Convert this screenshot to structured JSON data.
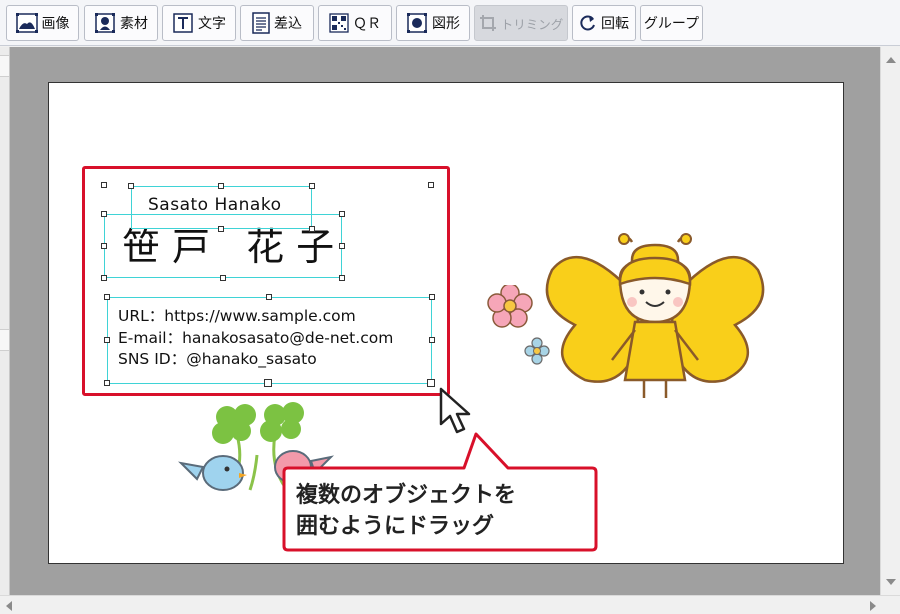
{
  "toolbar": {
    "buttons": [
      {
        "label": "画像",
        "icon": "image-icon",
        "enabled": true
      },
      {
        "label": "素材",
        "icon": "material-icon",
        "enabled": true
      },
      {
        "label": "文字",
        "icon": "text-icon",
        "enabled": true
      },
      {
        "label": "差込",
        "icon": "merge-icon",
        "enabled": true
      },
      {
        "label": "ＱＲ",
        "icon": "qr-icon",
        "enabled": true
      },
      {
        "label": "図形",
        "icon": "shape-icon",
        "enabled": true
      },
      {
        "label": "トリミング",
        "icon": "crop-icon",
        "enabled": false
      },
      {
        "label": "回転",
        "icon": "rotate-icon",
        "enabled": true
      },
      {
        "label": "グループ",
        "icon": "",
        "enabled": true
      }
    ]
  },
  "card": {
    "name_romaji": "Sasato Hanako",
    "name_kanji": "笹戸 花子",
    "contact": [
      "URL：https://www.sample.com",
      "E-mail：hanakosasato@de-net.com",
      "SNS ID：@hanako_sasato"
    ]
  },
  "callout": {
    "line1": "複数のオブジェクトを",
    "line2": "囲むようにドラッグ"
  },
  "colors": {
    "selection": "#3fd3d6",
    "highlight": "#d8102a",
    "canvas_bg": "#a0a0a0"
  }
}
